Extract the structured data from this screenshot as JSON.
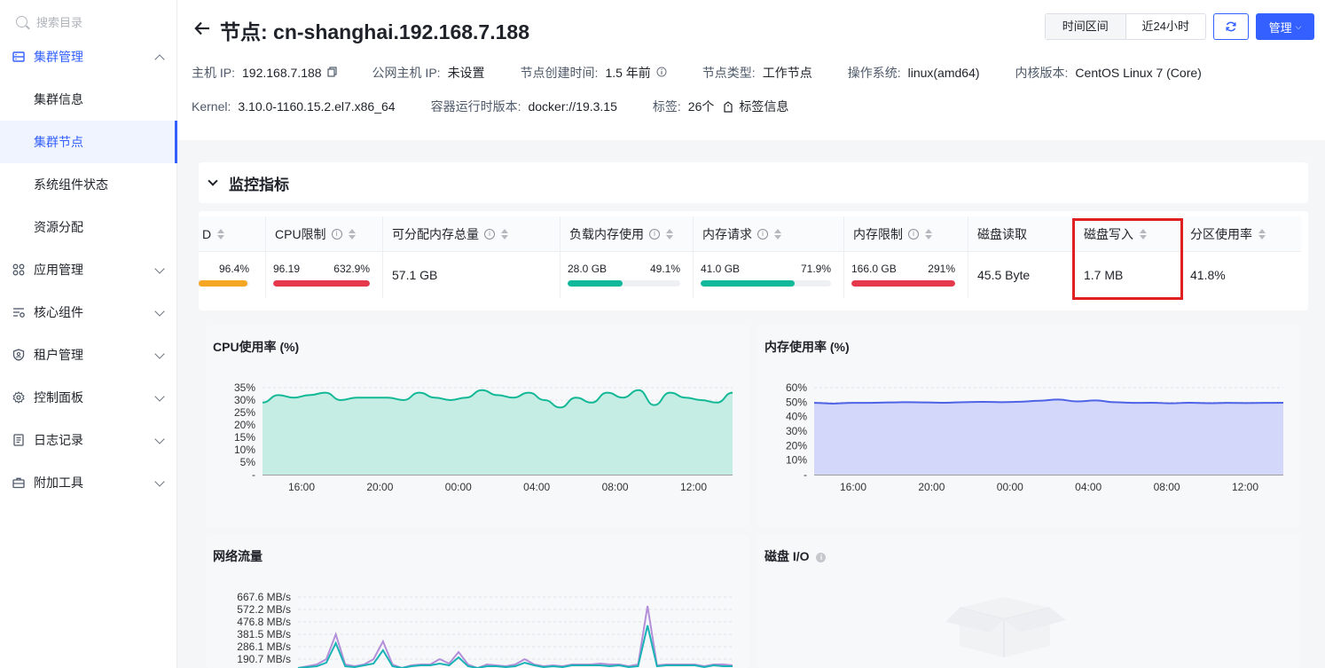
{
  "sidebar": {
    "search_placeholder": "搜索目录",
    "groups": [
      {
        "label": "集群管理",
        "icon": "cluster-icon",
        "expanded": true
      },
      {
        "label": "应用管理",
        "icon": "apps-icon"
      },
      {
        "label": "核心组件",
        "icon": "components-icon"
      },
      {
        "label": "租户管理",
        "icon": "tenant-icon"
      },
      {
        "label": "控制面板",
        "icon": "gear-icon"
      },
      {
        "label": "日志记录",
        "icon": "log-icon"
      },
      {
        "label": "附加工具",
        "icon": "toolbox-icon"
      }
    ],
    "sub_items": [
      {
        "label": "集群信息"
      },
      {
        "label": "集群节点",
        "active": true
      },
      {
        "label": "系统组件状态"
      },
      {
        "label": "资源分配"
      }
    ]
  },
  "header": {
    "title": "节点: cn-shanghai.192.168.7.188",
    "range_label": "时间区间",
    "range_value": "近24小时",
    "manage_label": "管理",
    "info": {
      "host_ip_label": "主机 IP:",
      "host_ip": "192.168.7.188",
      "public_ip_label": "公网主机 IP:",
      "public_ip": "未设置",
      "created_label": "节点创建时间:",
      "created": "1.5 年前",
      "type_label": "节点类型:",
      "type": "工作节点",
      "os_label": "操作系统:",
      "os": "linux(amd64)",
      "kernel_ver_label": "内核版本:",
      "kernel_ver": "CentOS Linux 7 (Core)",
      "kernel_label": "Kernel:",
      "kernel": "3.10.0-1160.15.2.el7.x86_64",
      "runtime_label": "容器运行时版本:",
      "runtime": "docker://19.3.15",
      "tags_label": "标签:",
      "tags_count": "26个",
      "tags_link": "标签信息"
    }
  },
  "monitor": {
    "title": "监控指标",
    "columns": [
      {
        "header": "D",
        "pct": "96.4%",
        "ratio": 0.964,
        "color": "#f5a623"
      },
      {
        "header": "CPU限制",
        "val": "96.19",
        "pct": "632.9%",
        "ratio": 1.0,
        "color": "#e5384d"
      },
      {
        "header": "可分配内存总量",
        "value": "57.1 GB"
      },
      {
        "header": "负载内存使用",
        "val": "28.0 GB",
        "pct": "49.1%",
        "ratio": 0.491,
        "color": "#10b99a"
      },
      {
        "header": "内存请求",
        "val": "41.0 GB",
        "pct": "71.9%",
        "ratio": 0.719,
        "color": "#10b99a"
      },
      {
        "header": "内存限制",
        "val": "166.0 GB",
        "pct": "291%",
        "ratio": 1.0,
        "color": "#e5384d"
      },
      {
        "header": "磁盘读取",
        "value": "45.5 Byte"
      },
      {
        "header": "磁盘写入",
        "value": "1.7 MB"
      },
      {
        "header": "分区使用率",
        "value": "41.8%"
      }
    ]
  },
  "charts": {
    "cpu": {
      "title": "CPU使用率 (%)",
      "color": "#13b896",
      "fill": "#c5ede4"
    },
    "mem": {
      "title": "内存使用率 (%)",
      "color": "#4f63e6",
      "fill": "#d3d8fb"
    },
    "net": {
      "title": "网络流量"
    },
    "disk": {
      "title": "磁盘 I/O"
    }
  },
  "chart_data": [
    {
      "type": "area",
      "title": "CPU使用率 (%)",
      "x_ticks": [
        "16:00",
        "20:00",
        "00:00",
        "04:00",
        "08:00",
        "12:00"
      ],
      "y_ticks": [
        "35%",
        "30%",
        "25%",
        "20%",
        "15%",
        "10%",
        "5%",
        "-"
      ],
      "ylim": [
        0,
        35
      ],
      "values": [
        29,
        32,
        31,
        32,
        33,
        30,
        31,
        31,
        31,
        30,
        33,
        31,
        30,
        31,
        34,
        32,
        31,
        33,
        30,
        27,
        31,
        29,
        33,
        31,
        34,
        28,
        33,
        31,
        30,
        29,
        33
      ]
    },
    {
      "type": "area",
      "title": "内存使用率 (%)",
      "x_ticks": [
        "16:00",
        "20:00",
        "00:00",
        "04:00",
        "08:00",
        "12:00"
      ],
      "y_ticks": [
        "60%",
        "50%",
        "40%",
        "30%",
        "20%",
        "10%",
        "-"
      ],
      "ylim": [
        0,
        60
      ],
      "values": [
        49.5,
        49,
        49.5,
        49.5,
        49.8,
        50,
        49.8,
        49.6,
        50,
        50.2,
        50,
        50.3,
        51,
        51.8,
        50.5,
        51.2,
        50,
        49.5,
        49.6,
        49.2,
        49.6,
        49.3,
        49.5,
        49.4,
        49.5,
        49.6
      ]
    },
    {
      "type": "line",
      "title": "网络流量",
      "y_ticks": [
        "667.6 MB/s",
        "572.2 MB/s",
        "476.8 MB/s",
        "381.5 MB/s",
        "286.1 MB/s",
        "190.7 MB/s"
      ]
    }
  ]
}
